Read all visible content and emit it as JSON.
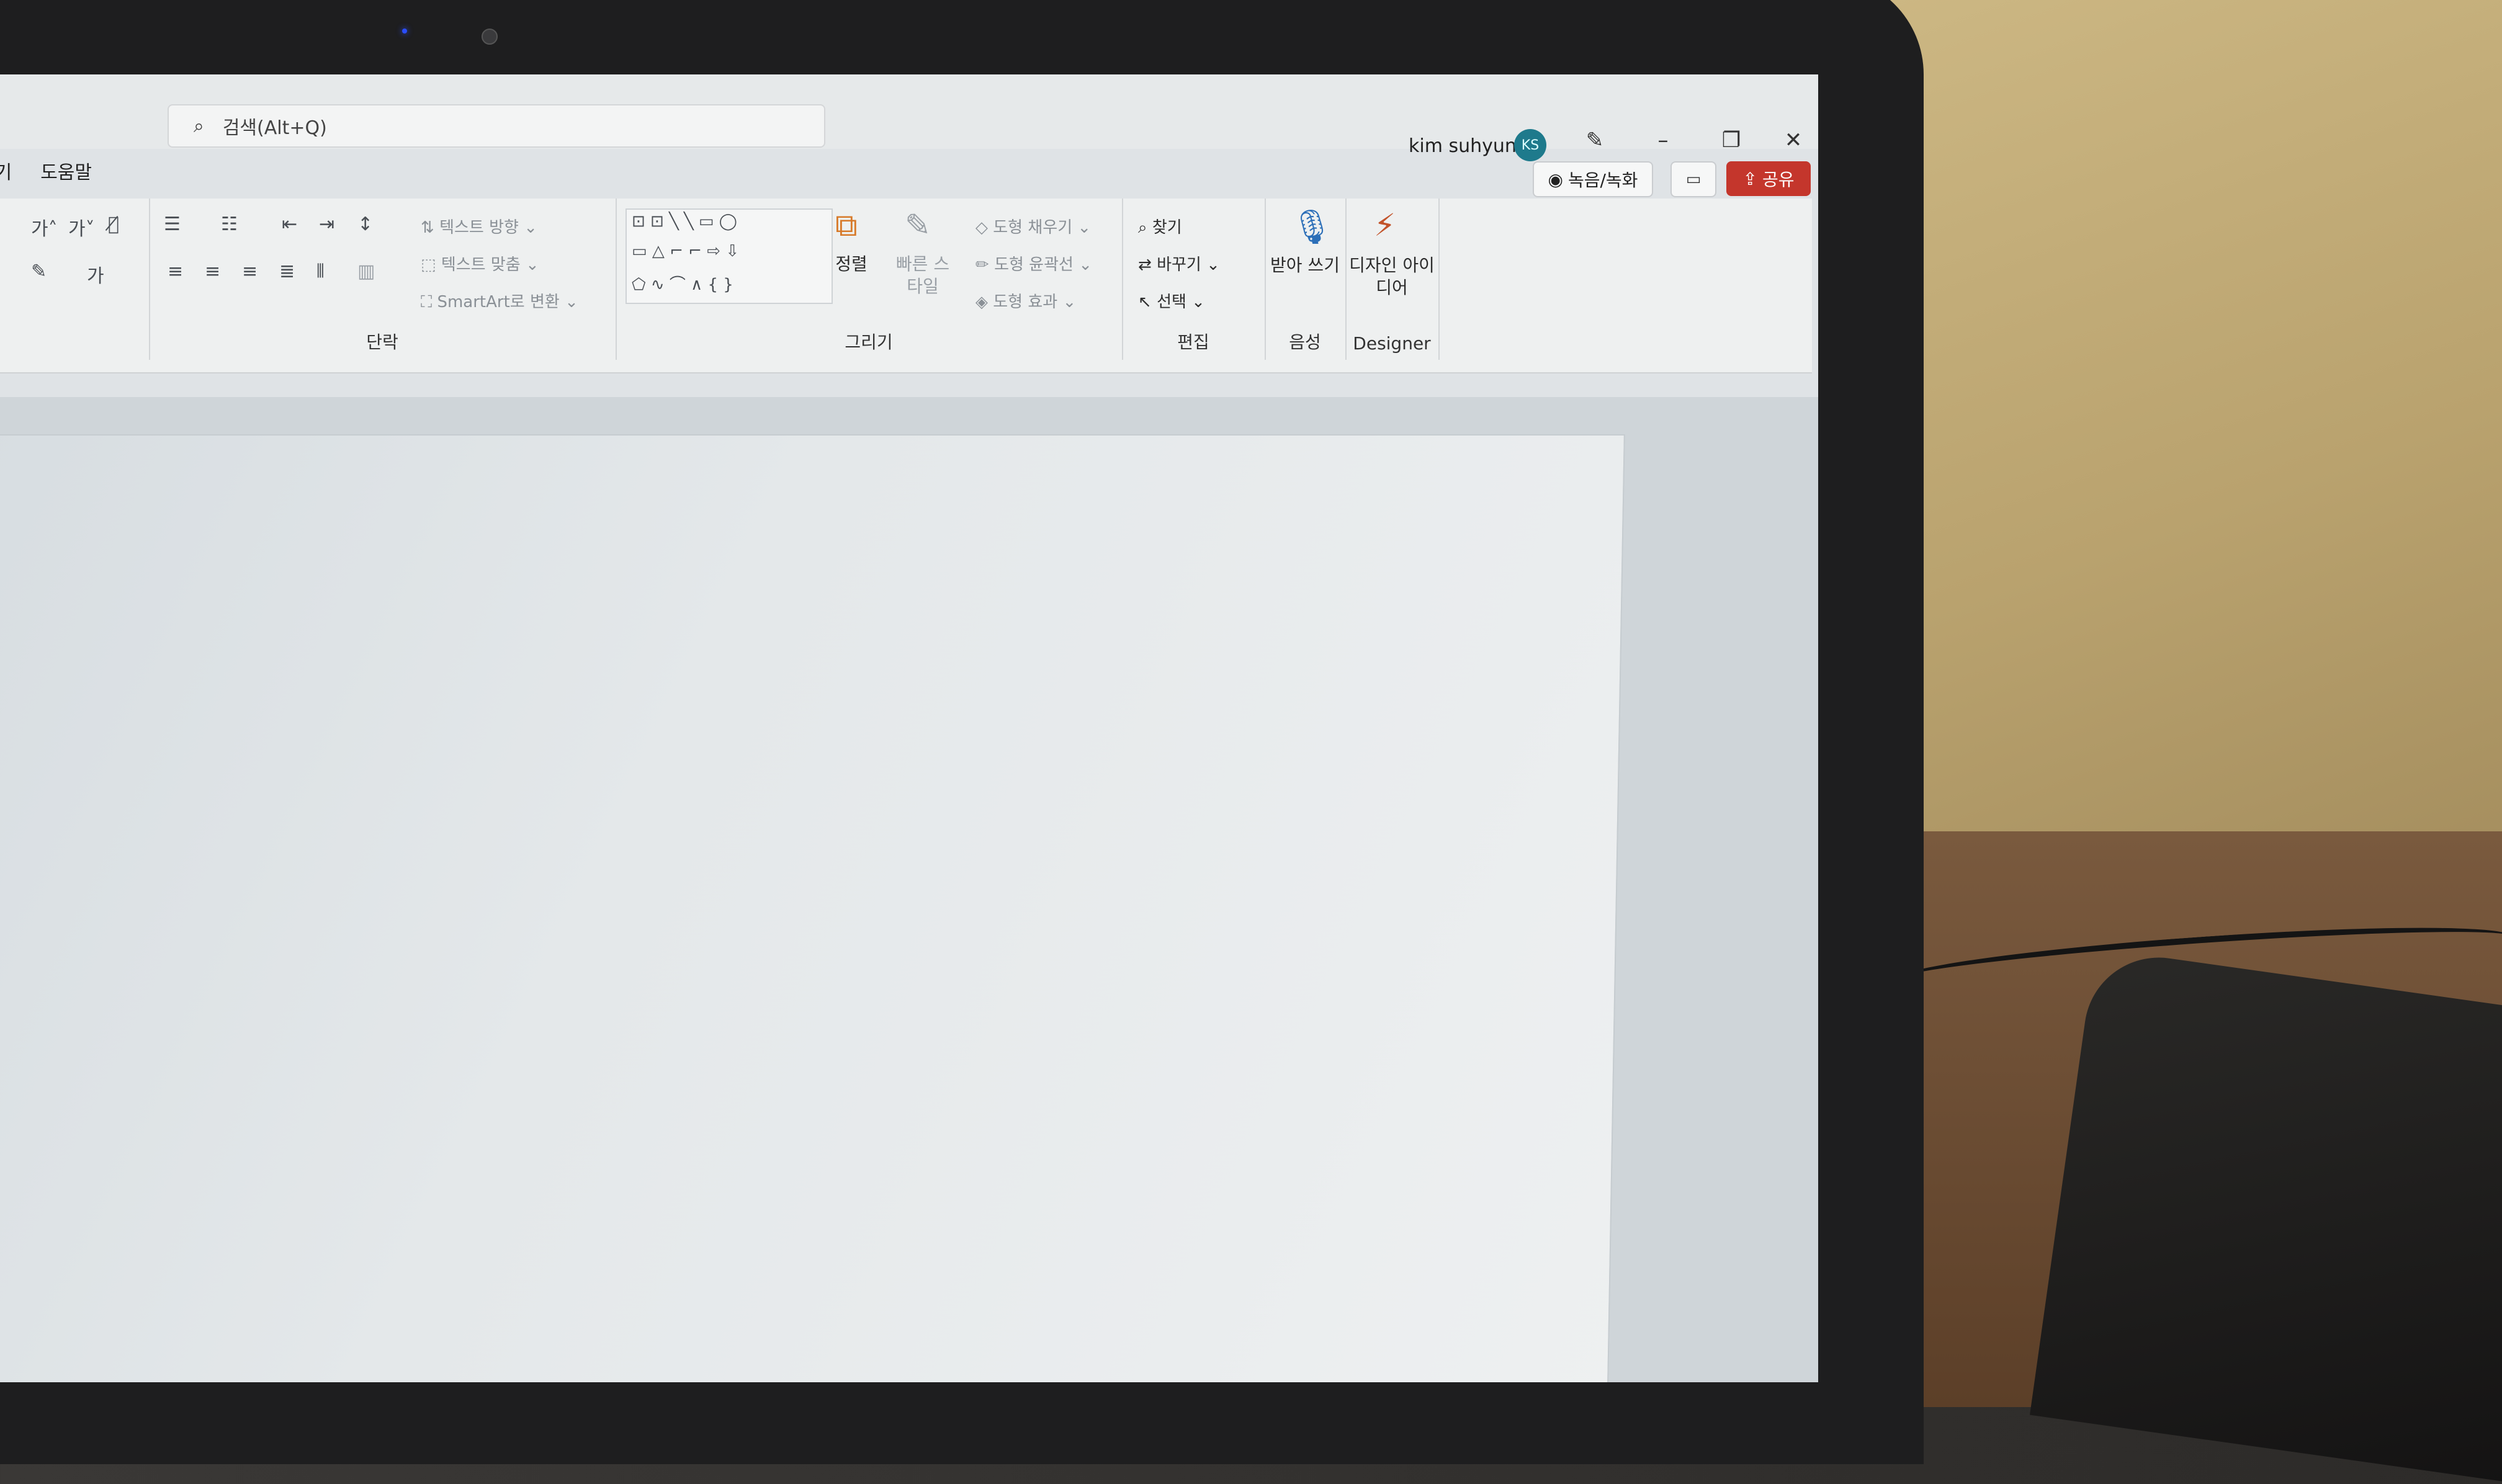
{
  "search": {
    "placeholder": "검색(Alt+Q)"
  },
  "user": {
    "name": "kim suhyun",
    "initials": "KS"
  },
  "tabs": [
    "보기",
    "도움말"
  ],
  "ribbon": {
    "paragraph": {
      "text_direction": "텍스트 방향",
      "align_text": "텍스트 맞춤",
      "smartart": "SmartArt로 변환",
      "label": "단락"
    },
    "drawing": {
      "arrange": "정렬",
      "quick_styles": "빠른 스타일",
      "shape_fill": "도형 채우기",
      "shape_outline": "도형 윤곽선",
      "shape_effects": "도형 효과",
      "label": "그리기"
    },
    "editing": {
      "find": "찾기",
      "replace": "바꾸기",
      "select": "선택",
      "label": "편집"
    },
    "voice": {
      "dictate": "받아 쓰기",
      "label": "음성"
    },
    "designer": {
      "ideas": "디자인 아이디어",
      "label": "Designer"
    }
  },
  "actions": {
    "record": "녹음/녹화",
    "share": "공유"
  }
}
